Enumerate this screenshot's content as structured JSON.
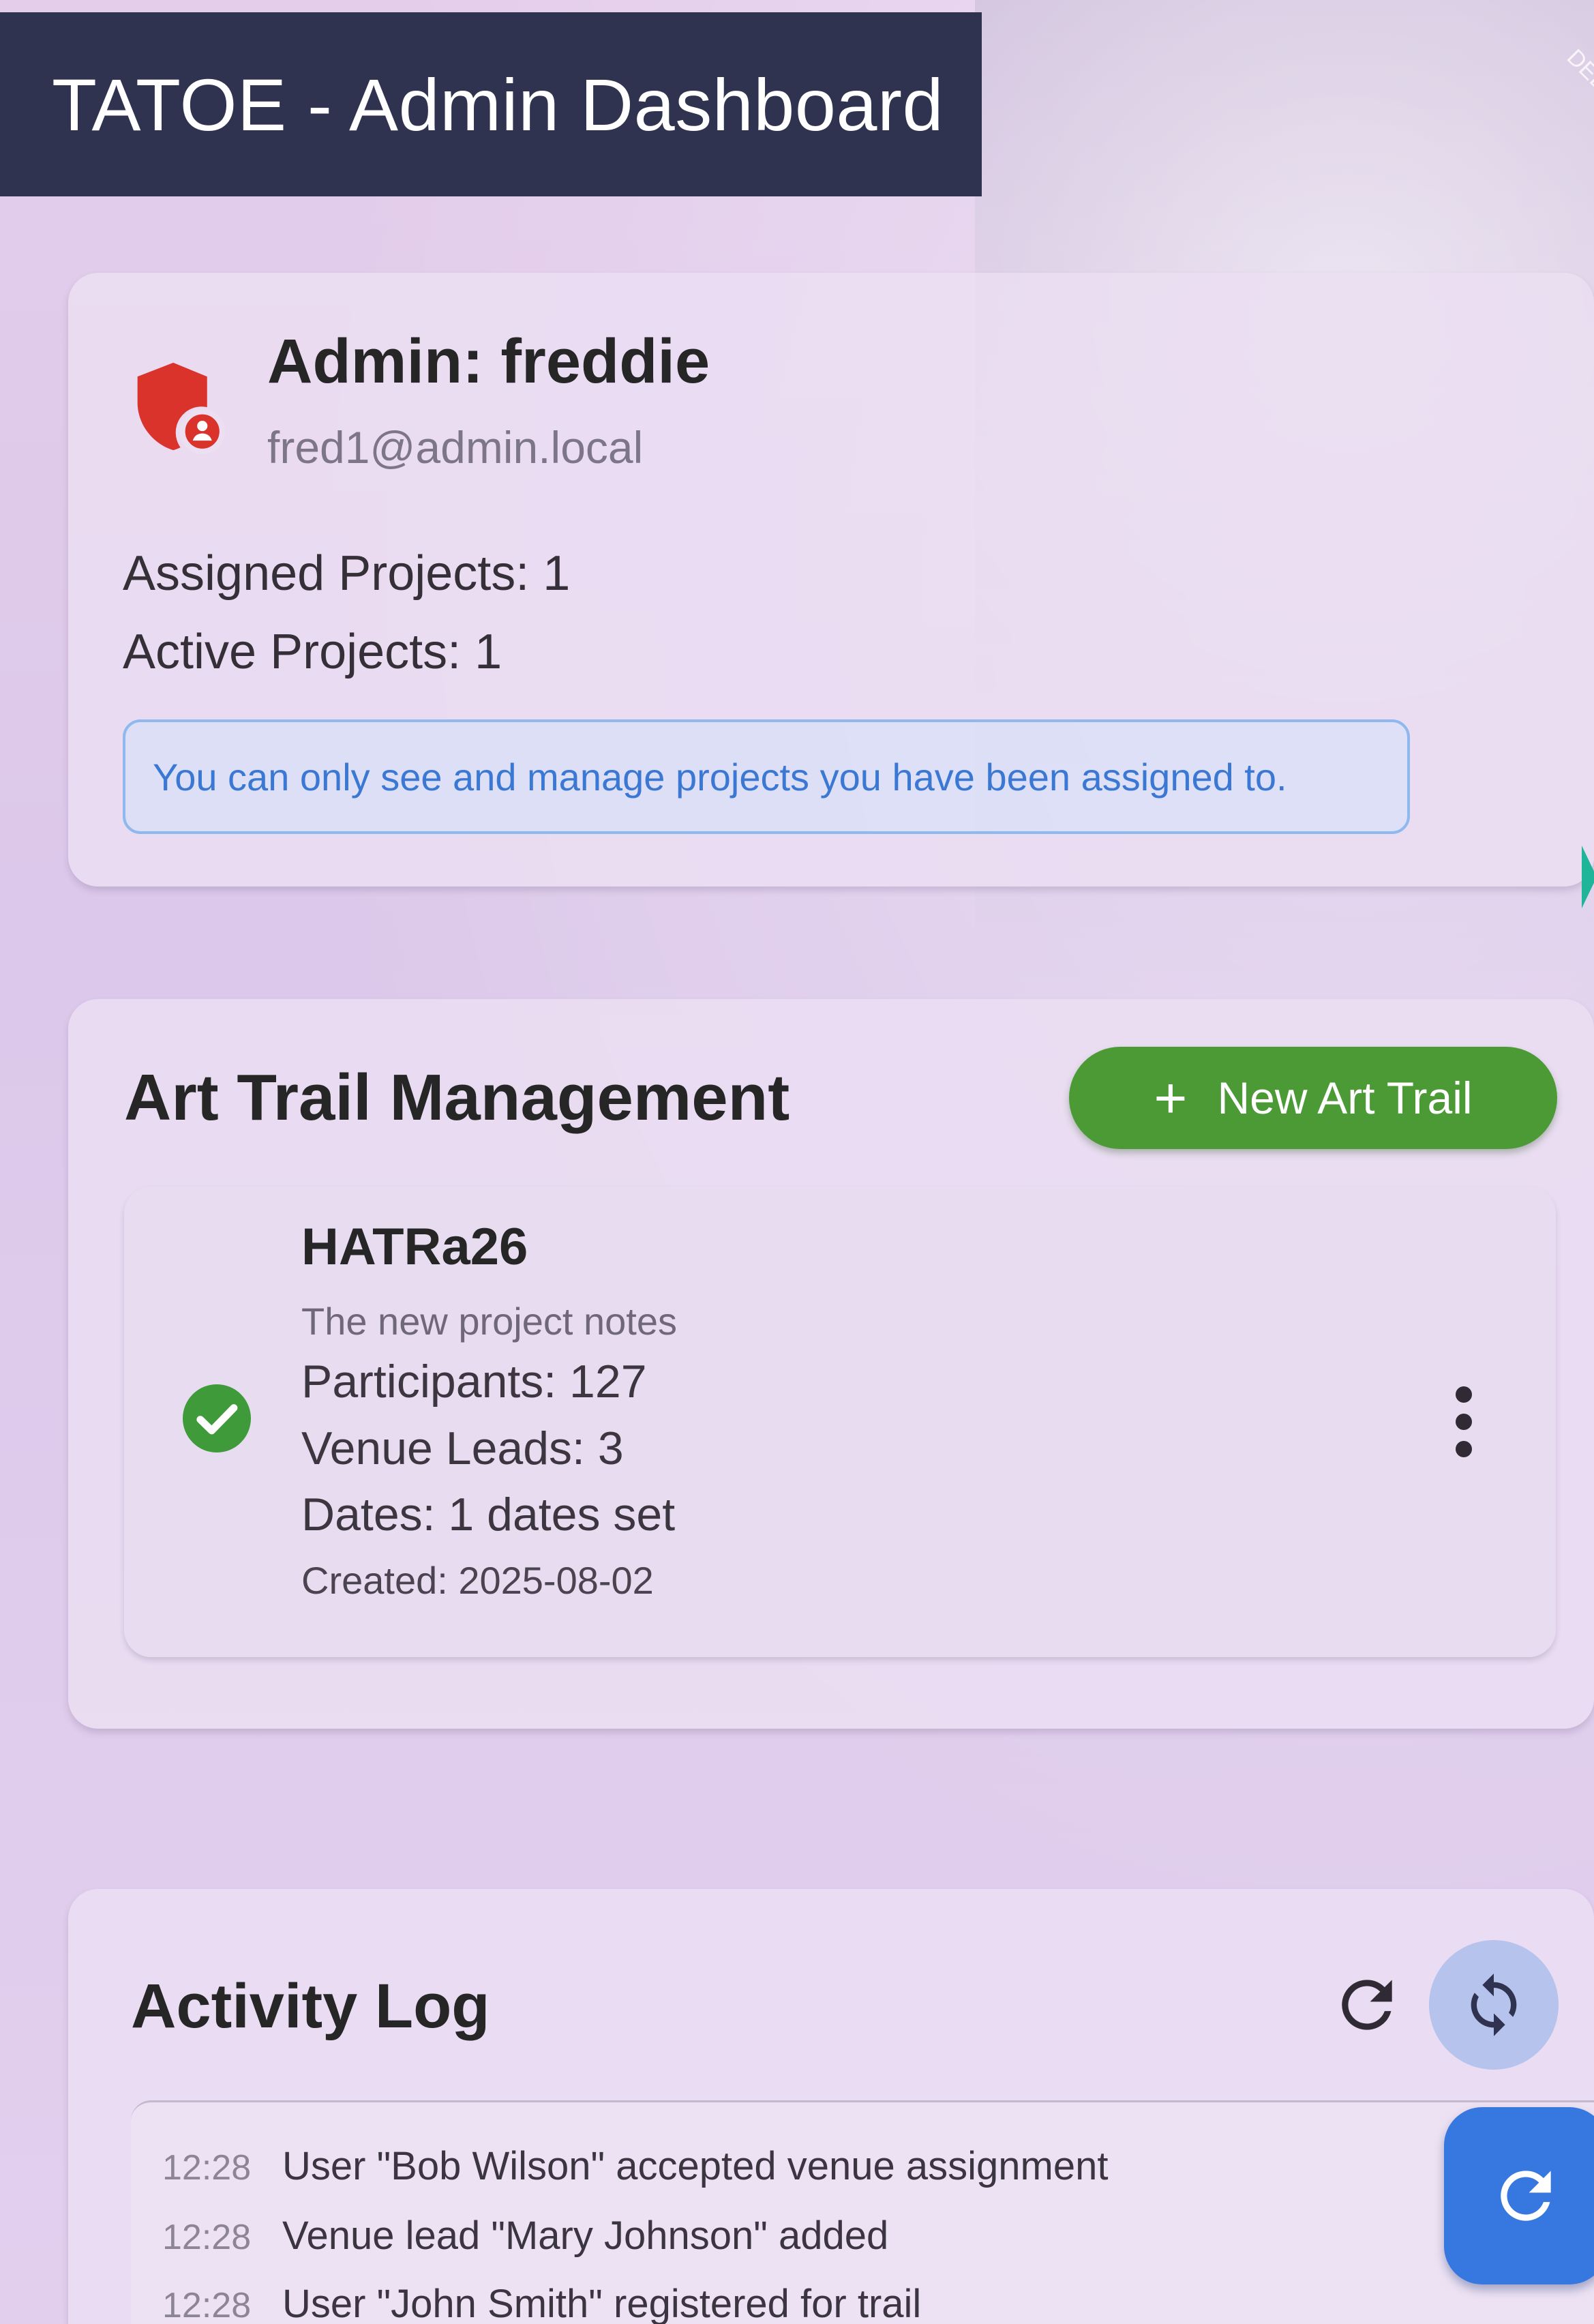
{
  "app_bar": {
    "title": "TATOE - Admin Dashboard",
    "debug_banner": "DEB"
  },
  "admin_card": {
    "icon": "admin-shield-icon",
    "name": "Admin: freddie",
    "email": "fred1@admin.local",
    "assigned_projects": "Assigned Projects: 1",
    "active_projects": "Active Projects: 1",
    "info_text": "You can only see and manage projects you have been assigned to."
  },
  "art_trail": {
    "title": "Art Trail Management",
    "new_button": "New Art Trail",
    "projects": [
      {
        "name": "HATRa26",
        "notes": "The new project notes",
        "participants": "Participants: 127",
        "venue_leads": "Venue Leads: 3",
        "dates": "Dates: 1 dates set",
        "created": "Created: 2025-08-02",
        "status_icon": "check-circle-icon"
      }
    ]
  },
  "activity": {
    "title": "Activity Log",
    "entries": [
      {
        "time": "12:28",
        "text": "User \"Bob Wilson\" accepted venue assignment"
      },
      {
        "time": "12:28",
        "text": "Venue lead \"Mary Johnson\" added"
      },
      {
        "time": "12:28",
        "text": "User \"John Smith\" registered for trail"
      }
    ]
  },
  "colors": {
    "app_bar": "#2f3350",
    "accent_green": "#4c9a36",
    "accent_blue": "#3778e0",
    "admin_red": "#d9332b",
    "info_blue": "#3a78d4"
  }
}
